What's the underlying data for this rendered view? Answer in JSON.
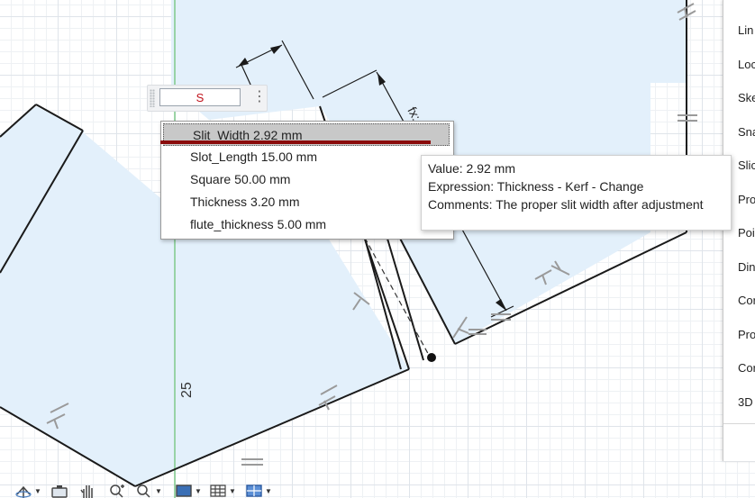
{
  "canvas": {
    "dimension_label": "25",
    "dimension_fx": "fx:"
  },
  "expression_input": {
    "value": "S"
  },
  "autocomplete": {
    "items": [
      {
        "name": "Slit_Width",
        "value": "2.92 mm",
        "selected": true
      },
      {
        "name": "Slot_Length",
        "value": "15.00 mm",
        "selected": false
      },
      {
        "name": "Square",
        "value": "50.00 mm",
        "selected": false
      },
      {
        "name": "Thickness",
        "value": "3.20 mm",
        "selected": false
      },
      {
        "name": "flute_thickness",
        "value": "5.00 mm",
        "selected": false
      }
    ]
  },
  "tooltip": {
    "value_line": "Value: 2.92 mm",
    "expression_line": "Expression: Thickness - Kerf - Change",
    "comments_line": "Comments: The proper slit width after adjustment"
  },
  "right_panel": {
    "items": [
      "Lin",
      "Loc",
      "Ske",
      "Sna",
      "Slic",
      "Pro",
      "Poi",
      "Din",
      "Cor",
      "Pro",
      "Cor",
      "3D"
    ]
  },
  "bottom_toolbar": {
    "icons": [
      "orbit-icon",
      "camera-icon",
      "pan-hand-icon",
      "zoom-icon",
      "zoom-window-icon",
      "display-mode-icon",
      "grid-icon",
      "viewports-icon"
    ]
  },
  "colors": {
    "sketch_fill": "#e3f0fb",
    "sketch_line": "#1a1a1a",
    "axis_green": "#7fc98a",
    "constraint_gray": "#9a9a9a",
    "selection_underline": "#8a0b0b",
    "input_text": "#c0121b"
  }
}
